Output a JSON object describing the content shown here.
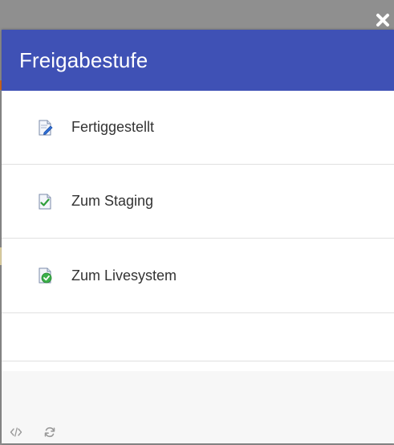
{
  "dialog": {
    "title": "Freigabestufe",
    "close_icon": "close-icon",
    "header_color": "#3f51b5"
  },
  "options": [
    {
      "label": "Fertiggestellt",
      "icon": "document-edit-icon"
    },
    {
      "label": "Zum Staging",
      "icon": "document-check-icon"
    },
    {
      "label": "Zum Livesystem",
      "icon": "document-check-circle-icon"
    }
  ],
  "footer": {
    "icons": [
      "code-icon",
      "refresh-icon"
    ]
  }
}
